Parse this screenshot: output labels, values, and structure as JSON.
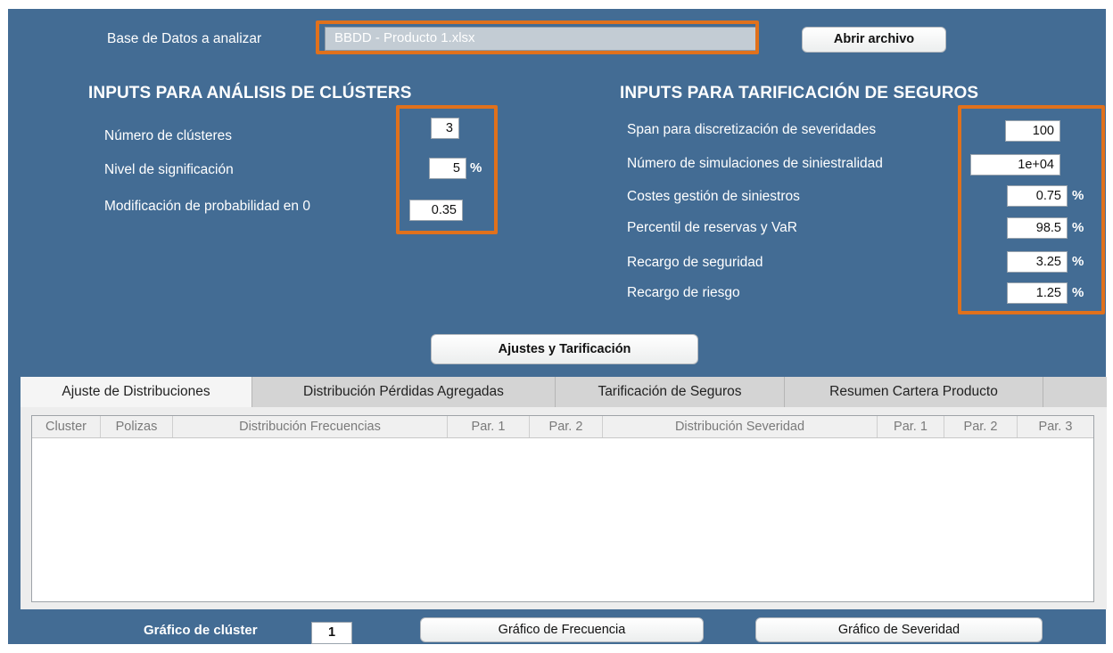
{
  "top": {
    "db_label": "Base de Datos a analizar",
    "db_value": "BBDD - Producto 1.xlsx",
    "open_button": "Abrir archivo"
  },
  "clusters": {
    "heading": "INPUTS PARA ANÁLISIS DE CLÚSTERS",
    "num_clusters_label": "Número de clústeres",
    "num_clusters_value": "3",
    "significance_label": "Nivel de significación",
    "significance_value": "5",
    "prob_mod_label": "Modificación de probabilidad en 0",
    "prob_mod_value": "0.35",
    "percent": "%"
  },
  "pricing": {
    "heading": "INPUTS PARA TARIFICACIÓN DE SEGUROS",
    "percent": "%",
    "rows": [
      {
        "label": "Span para discretización de severidades",
        "value": "100"
      },
      {
        "label": "Número de simulaciones de siniestralidad",
        "value": "1e+04"
      },
      {
        "label": "Costes gestión de siniestros",
        "value": "0.75"
      },
      {
        "label": "Percentil de reservas y VaR",
        "value": "98.5"
      },
      {
        "label": "Recargo de seguridad",
        "value": "3.25"
      },
      {
        "label": "Recargo de riesgo",
        "value": "1.25"
      }
    ]
  },
  "actions": {
    "fit_button": "Ajustes y Tarificación"
  },
  "tabs": [
    {
      "label": "Ajuste de Distribuciones",
      "active": true
    },
    {
      "label": "Distribución Pérdidas Agregadas",
      "active": false
    },
    {
      "label": "Tarificación de Seguros",
      "active": false
    },
    {
      "label": "Resumen Cartera Producto",
      "active": false
    }
  ],
  "table": {
    "columns": [
      "Cluster",
      "Polizas",
      "Distribución Frecuencias",
      "Par. 1",
      "Par. 2",
      "Distribución Severidad",
      "Par. 1",
      "Par. 2",
      "Par. 3"
    ],
    "rows": []
  },
  "bottom": {
    "cluster_chart_label": "Gráfico de clúster",
    "cluster_chart_value": "1",
    "freq_button": "Gráfico de Frecuencia",
    "sev_button": "Gráfico de Severidad"
  },
  "colors": {
    "panel_bg": "#436c94",
    "highlight": "#e0711c",
    "db_field_bg": "#c3ccd4"
  }
}
